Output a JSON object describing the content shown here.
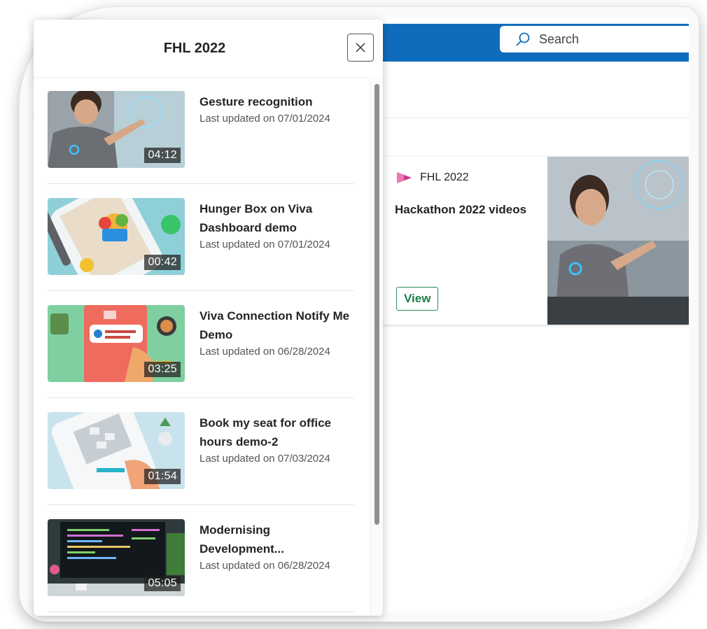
{
  "search": {
    "placeholder": "Search"
  },
  "panel": {
    "title": "FHL 2022",
    "videos": [
      {
        "title": "Gesture recognition",
        "meta": "Last updated on 07/01/2024",
        "duration": "04:12"
      },
      {
        "title": "Hunger Box on Viva Dashboard demo",
        "meta": "Last updated on 07/01/2024",
        "duration": "00:42"
      },
      {
        "title": "Viva Connection Notify Me Demo",
        "meta": "Last updated on 06/28/2024",
        "duration": "03:25"
      },
      {
        "title": "Book my seat for office hours demo-2",
        "meta": "Last updated on 07/03/2024",
        "duration": "01:54"
      },
      {
        "title": "Modernising Development...",
        "meta": "Last updated on 06/28/2024",
        "duration": "05:05"
      }
    ]
  },
  "card": {
    "tag": "FHL 2022",
    "title": "Hackathon 2022 videos",
    "view_label": "View"
  },
  "colors": {
    "header": "#0f6cbd",
    "accent_green": "#1d7d45",
    "stream_pink": "#d0368a"
  }
}
